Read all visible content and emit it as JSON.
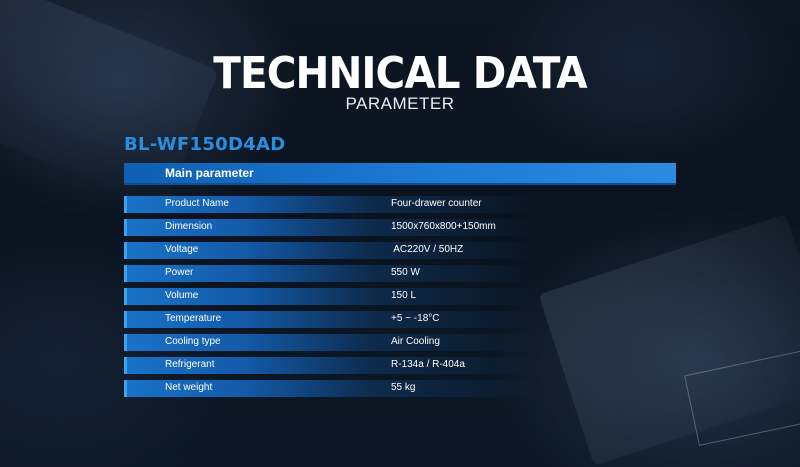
{
  "header": {
    "title": "TECHNICAL DATA",
    "subtitle": "PARAMETER"
  },
  "model": "BL-WF150D4AD",
  "table": {
    "section_label": "Main parameter",
    "rows": [
      {
        "name": "Product Name",
        "value": "Four-drawer counter"
      },
      {
        "name": "Dimension",
        "value": "1500x760x800+150mm"
      },
      {
        "name": "Voltage",
        "value": " AC220V / 50HZ"
      },
      {
        "name": "Power",
        "value": "550 W"
      },
      {
        "name": "Volume",
        "value": "150 L"
      },
      {
        "name": "Temperature",
        "value": "+5 ~ -18°C"
      },
      {
        "name": "Cooling type",
        "value": "Air Cooling"
      },
      {
        "name": "Refrigerant",
        "value": "R-134a / R-404a"
      },
      {
        "name": "Net weight",
        "value": "55 kg"
      }
    ]
  },
  "colors": {
    "accent": "#2a8ee0",
    "header_bar": "#1d7ad4",
    "background": "#0b1520"
  }
}
